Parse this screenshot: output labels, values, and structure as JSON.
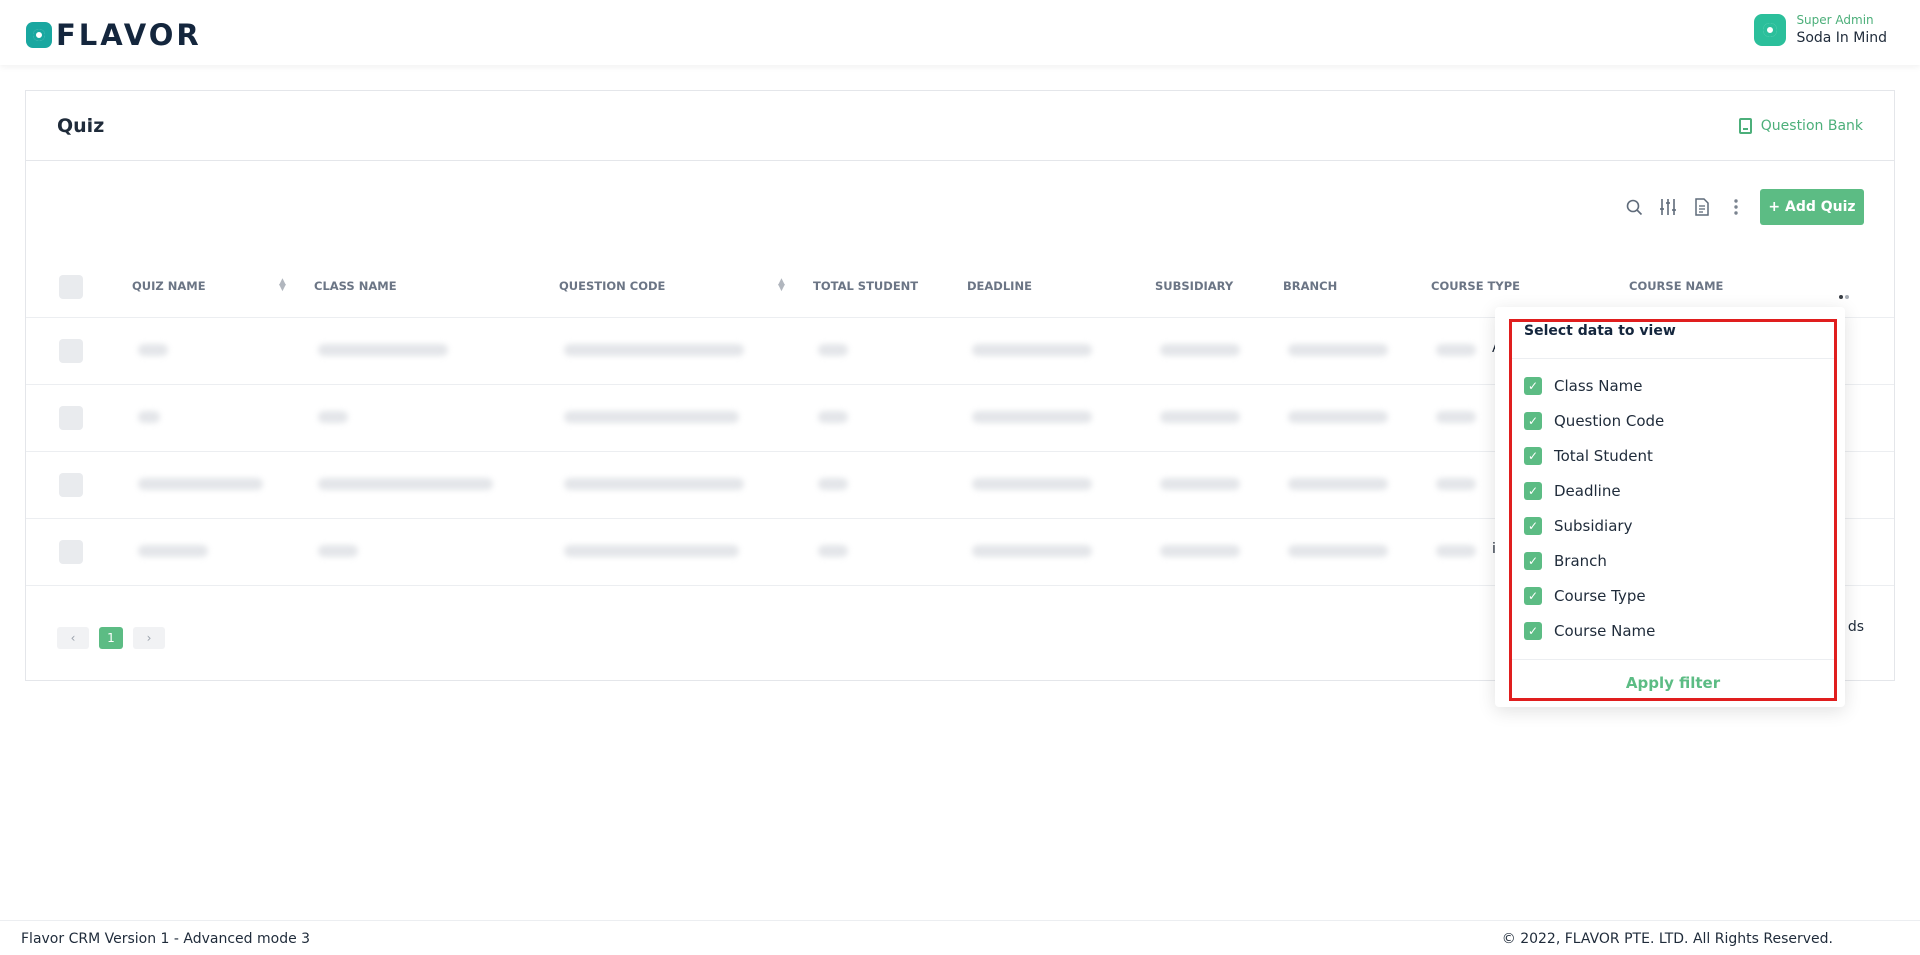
{
  "header": {
    "logo_text": "FLAVOR",
    "user_role": "Super Admin",
    "user_name": "Soda In Mind"
  },
  "page": {
    "title": "Quiz",
    "question_bank_label": "Question Bank",
    "add_button_label": "+ Add Quiz"
  },
  "table": {
    "columns": {
      "quiz_name": "QUIZ NAME",
      "class_name": "CLASS NAME",
      "question_code": "QUESTION CODE",
      "total_student": "TOTAL STUDENT",
      "deadline": "DEADLINE",
      "subsidiary": "SUBSIDIARY",
      "branch": "BRANCH",
      "course_type": "COURSE TYPE",
      "course_name": "COURSE NAME"
    },
    "peek_text": {
      "r1": "A",
      "r4": "i",
      "records_suffix": "ds"
    }
  },
  "pagination": {
    "prev": "‹",
    "current": "1",
    "next": "›"
  },
  "column_filter": {
    "title": "Select data to view",
    "options": [
      {
        "label": "Class Name",
        "checked": true
      },
      {
        "label": "Question Code",
        "checked": true
      },
      {
        "label": "Total Student",
        "checked": true
      },
      {
        "label": "Deadline",
        "checked": true
      },
      {
        "label": "Subsidiary",
        "checked": true
      },
      {
        "label": "Branch",
        "checked": true
      },
      {
        "label": "Course Type",
        "checked": true
      },
      {
        "label": "Course Name",
        "checked": true
      }
    ],
    "apply_label": "Apply filter"
  },
  "footer": {
    "version": "Flavor CRM Version 1 - Advanced mode 3",
    "copyright": "© 2022, FLAVOR PTE. LTD. All Rights Reserved."
  },
  "colors": {
    "accent": "#5cbc84",
    "highlight": "#e01e1e",
    "brand": "#14263d"
  }
}
